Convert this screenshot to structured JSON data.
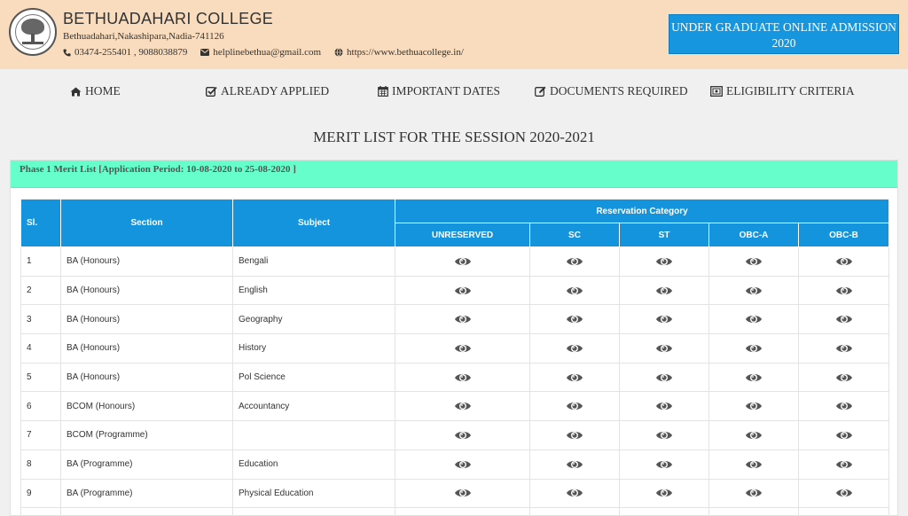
{
  "header": {
    "college_name": "BETHUADAHARI COLLEGE",
    "address": "Bethuadahari,Nakashipara,Nadia-741126",
    "phone": "03474-255401 , 9088038879",
    "email": "helplinebethua@gmail.com",
    "website": "https://www.bethuacollege.in/",
    "admission_line1": "UNDER GRADUATE ONLINE ADMISSION",
    "admission_line2": "2020"
  },
  "nav": {
    "items": [
      {
        "label": "HOME",
        "icon": "home-icon"
      },
      {
        "label": "ALREADY APPLIED",
        "icon": "check-square-icon"
      },
      {
        "label": "IMPORTANT DATES",
        "icon": "calendar-icon"
      },
      {
        "label": "DOCUMENTS REQUIRED",
        "icon": "edit-icon"
      },
      {
        "label": "ELIGIBILITY CRITERIA",
        "icon": "certificate-icon"
      }
    ]
  },
  "page_title": "MERIT LIST FOR THE SESSION 2020-2021",
  "panel_heading": "Phase 1 Merit List [Application Period: 10-08-2020 to 25-08-2020 ]",
  "table": {
    "headers": {
      "sl": "Sl.",
      "section": "Section",
      "subject": "Subject",
      "reservation": "Reservation Category",
      "categories": [
        "UNRESERVED",
        "SC",
        "ST",
        "OBC-A",
        "OBC-B"
      ]
    },
    "rows": [
      {
        "sl": "1",
        "section": "BA (Honours)",
        "subject": "Bengali"
      },
      {
        "sl": "2",
        "section": "BA (Honours)",
        "subject": "English"
      },
      {
        "sl": "3",
        "section": "BA (Honours)",
        "subject": "Geography"
      },
      {
        "sl": "4",
        "section": "BA (Honours)",
        "subject": "History"
      },
      {
        "sl": "5",
        "section": "BA (Honours)",
        "subject": "Pol Science"
      },
      {
        "sl": "6",
        "section": "BCOM (Honours)",
        "subject": "Accountancy"
      },
      {
        "sl": "7",
        "section": "BCOM (Programme)",
        "subject": ""
      },
      {
        "sl": "8",
        "section": "BA (Programme)",
        "subject": "Education"
      },
      {
        "sl": "9",
        "section": "BA (Programme)",
        "subject": "Physical Education"
      },
      {
        "sl": "",
        "section": "",
        "subject": ""
      }
    ]
  },
  "colors": {
    "header_bg": "#f9dcbd",
    "accent_blue": "#1494dd",
    "panel_heading_bg": "#66ffcc"
  }
}
